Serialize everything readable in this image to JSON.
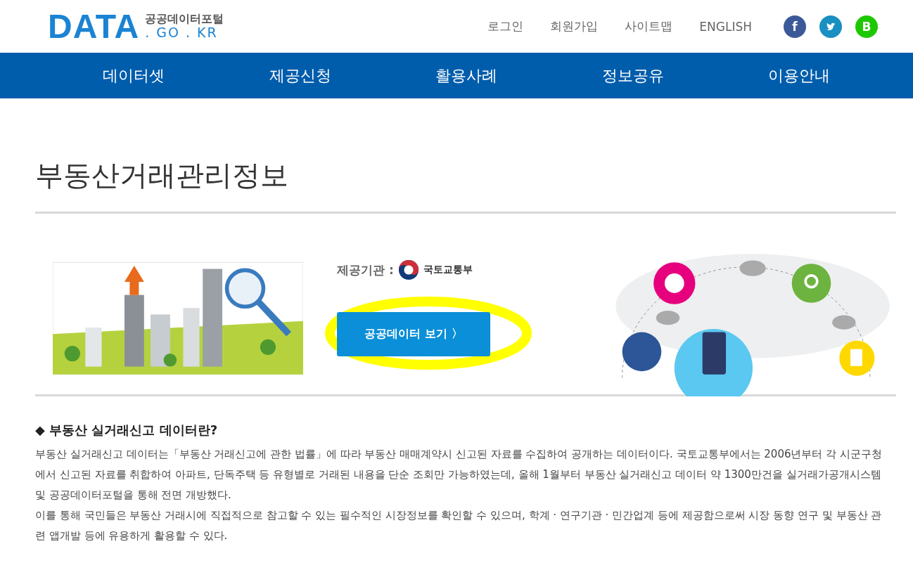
{
  "logo": {
    "main": "DATA",
    "sub_top": "공공데이터포털",
    "sub_bottom": ". GO . KR"
  },
  "util_links": [
    "로그인",
    "회원가입",
    "사이트맵",
    "ENGLISH"
  ],
  "social": [
    {
      "kind": "facebook",
      "label": "f",
      "color": "#3b5998"
    },
    {
      "kind": "twitter",
      "color": "#1a8fc1"
    },
    {
      "kind": "band",
      "label": "B",
      "color": "#1ec800"
    }
  ],
  "nav": [
    "데이터셋",
    "제공신청",
    "활용사례",
    "정보공유",
    "이용안내"
  ],
  "page_title": "부동산거래관리정보",
  "provider": {
    "label": "제공기관 :",
    "name": "국토교통부"
  },
  "view_button": {
    "label": "공공데이터 보기 〉",
    "highlighted": true
  },
  "section_heading": "◆ 부동산 실거래신고 데이터란?",
  "paragraphs": [
    " 부동산 실거래신고 데이터는「부동산 거래신고에 관한 법률」에 따라 부동산 매매계약시 신고된 자료를 수집하여 공개하는 데이터이다. 국토교통부에서는 2006년부터 각 시군구청에서 신고된 자료를 취합하여 아파트, 단독주택 등 유형별로 거래된 내용을 단순 조회만 가능하였는데, 올해 1월부터 부동산 실거래신고 데이터 약 1300만건을 실거래가공개시스템 및 공공데이터포털을 통해 전면 개방했다.",
    " 이를 통해 국민들은 부동산 거래시에 직접적으로 참고할 수 있는 필수적인 시장정보를 확인할 수 있으며, 학계 · 연구기관 · 민간업계 등에 제공함으로써 시장 동향 연구 및 부동산 관련 앱개발 등에 유용하게 활용할 수 있다."
  ]
}
